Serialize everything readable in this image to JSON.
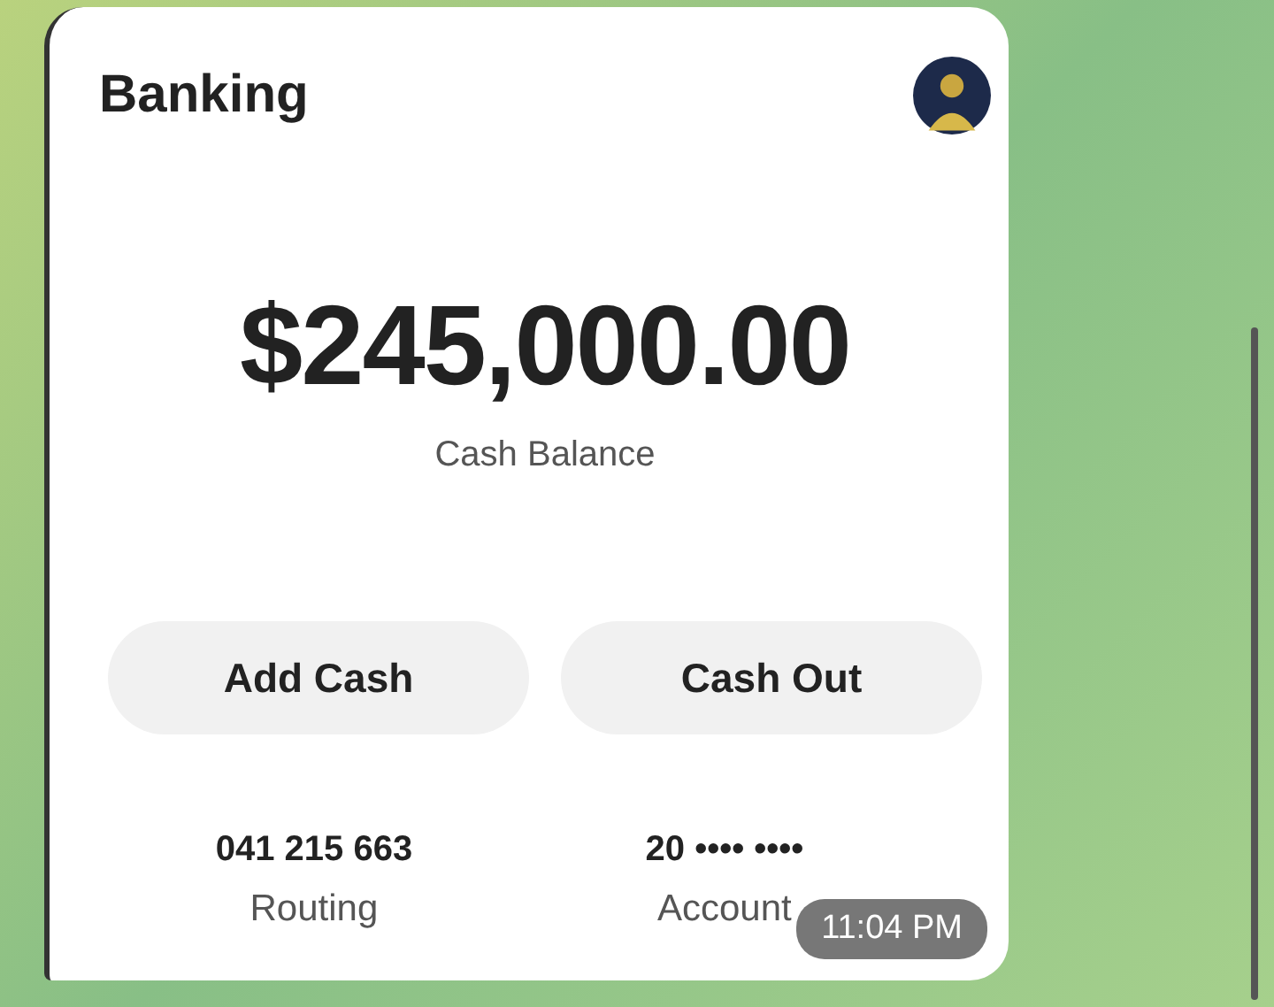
{
  "card": {
    "title": "Banking",
    "balance": "$245,000.00",
    "balance_label": "Cash Balance",
    "buttons": [
      "Add Cash",
      "Cash Out"
    ],
    "details": [
      {
        "value": "041 215 663",
        "label": "Routing"
      },
      {
        "value": "20 •••• ••••",
        "label": "Account"
      }
    ]
  },
  "message": {
    "time": "11:04 PM"
  }
}
